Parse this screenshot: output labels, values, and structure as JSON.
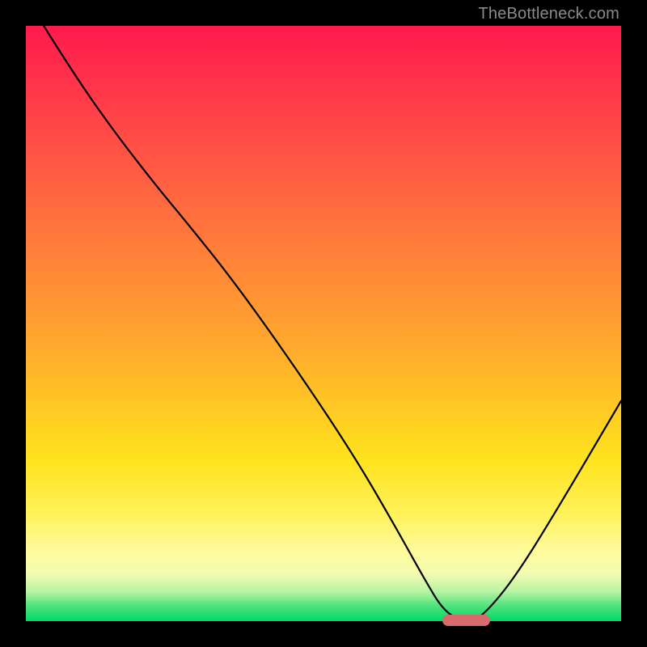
{
  "watermark": "TheBottleneck.com",
  "chart_data": {
    "type": "line",
    "title": "",
    "xlabel": "",
    "ylabel": "",
    "xlim": [
      0,
      100
    ],
    "ylim": [
      0,
      100
    ],
    "grid": false,
    "legend": false,
    "series": [
      {
        "name": "bottleneck-curve",
        "x": [
          3,
          8,
          15,
          22,
          27,
          35,
          45,
          55,
          62,
          67,
          70,
          73,
          76,
          82,
          90,
          100
        ],
        "y": [
          100,
          92,
          82,
          73,
          67,
          57,
          43,
          28,
          16,
          7,
          2,
          0,
          0,
          7,
          20,
          37
        ]
      }
    ],
    "annotations": [
      {
        "type": "pill",
        "name": "optimal-zone-marker",
        "x_start": 70,
        "x_end": 78,
        "y": 0,
        "color": "#d96b6f"
      }
    ],
    "background": {
      "type": "vertical-gradient",
      "stops": [
        {
          "pos": 0,
          "color": "#ff1a4d"
        },
        {
          "pos": 0.5,
          "color": "#ffaa2d"
        },
        {
          "pos": 0.85,
          "color": "#fff25a"
        },
        {
          "pos": 1.0,
          "color": "#00d96a"
        }
      ]
    }
  }
}
